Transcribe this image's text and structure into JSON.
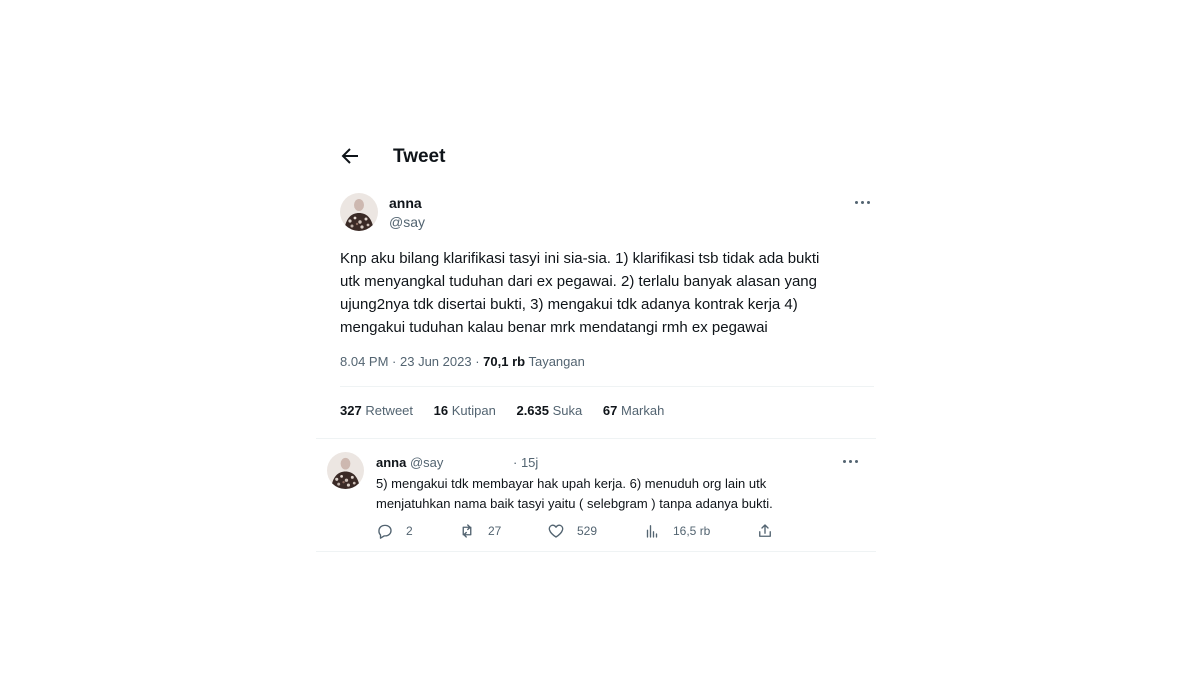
{
  "header": {
    "title": "Tweet",
    "back_icon": "arrow-left-icon"
  },
  "main_tweet": {
    "name": "anna",
    "handle": "@say",
    "text_lines": [
      "Knp aku bilang klarifikasi tasyi ini sia-sia. 1) klarifikasi tsb tidak ada bukti",
      "utk menyangkal tuduhan dari ex pegawai. 2) terlalu banyak alasan yang",
      "ujung2nya tdk disertai bukti, 3) mengakui tdk adanya kontrak kerja 4)",
      "mengakui tuduhan kalau benar mrk mendatangi rmh ex pegawai"
    ],
    "time": "8.04 PM",
    "date": "23 Jun 2023",
    "views_count": "70,1 rb",
    "views_label": "Tayangan"
  },
  "stats": {
    "retweets": {
      "count": "327",
      "label": "Retweet"
    },
    "quotes": {
      "count": "16",
      "label": "Kutipan"
    },
    "likes": {
      "count": "2.635",
      "label": "Suka"
    },
    "bookmarks": {
      "count": "67",
      "label": "Markah"
    }
  },
  "reply": {
    "name": "anna",
    "handle": "@say",
    "time": "15j",
    "text_lines": [
      "5) mengakui tdk membayar hak upah kerja. 6) menuduh org lain utk",
      "menjatuhkan nama baik tasyi yaitu ( selebgram ) tanpa adanya bukti."
    ],
    "actions": {
      "replies": "2",
      "retweets": "27",
      "likes": "529",
      "views": "16,5 rb"
    }
  },
  "colors": {
    "text": "#0f1419",
    "secondary": "#536471",
    "divider": "#eff3f4",
    "background": "#ffffff"
  },
  "icons": {
    "back": "arrow-left-icon",
    "more": "more-horizontal-icon",
    "reply": "reply-icon",
    "retweet": "retweet-icon",
    "like": "heart-icon",
    "views": "bar-chart-icon",
    "share": "share-icon"
  }
}
